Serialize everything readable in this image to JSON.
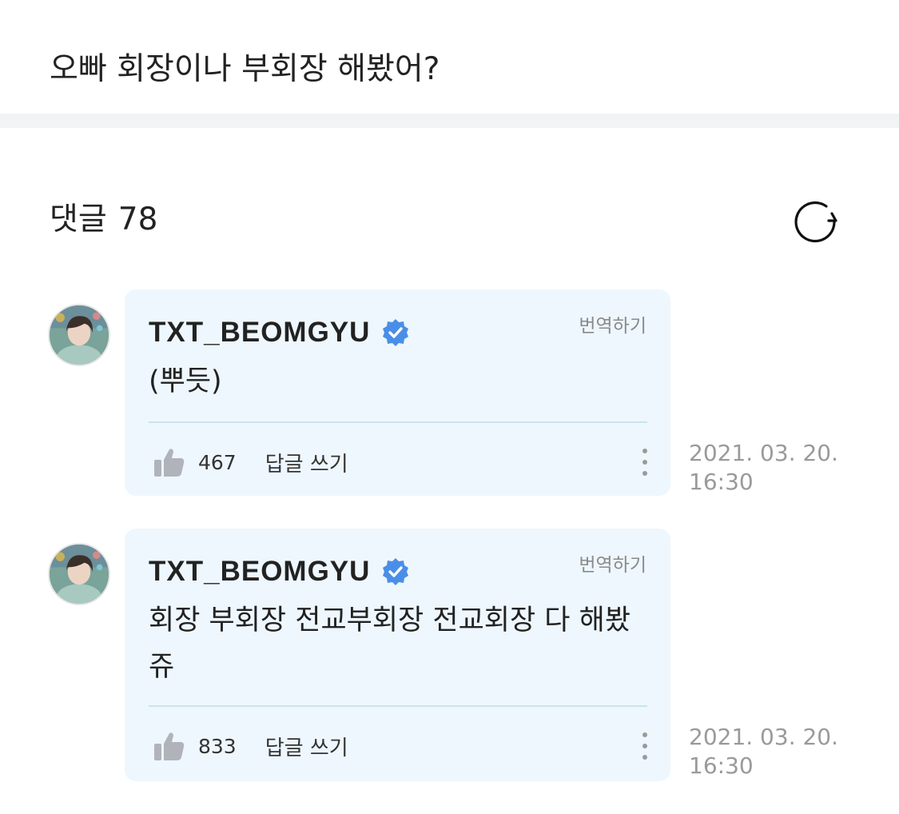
{
  "post": {
    "title": "오빠 회장이나 부회장 해봤어?"
  },
  "comments_section": {
    "label": "댓글",
    "count": "78",
    "refresh_icon": "refresh-icon"
  },
  "comments": [
    {
      "author": "TXT_BEOMGYU",
      "verified_icon": "verified-badge-icon",
      "translate_label": "번역하기",
      "body": "(뿌듯)",
      "like_icon": "thumbs-up-icon",
      "likes": "467",
      "reply_label": "답글 쓰기",
      "more_icon": "more-vertical-icon",
      "date": "2021. 03. 20.",
      "time": "16:30"
    },
    {
      "author": "TXT_BEOMGYU",
      "verified_icon": "verified-badge-icon",
      "translate_label": "번역하기",
      "body": "회장 부회장 전교부회장 전교회장 다 해봤쥬",
      "like_icon": "thumbs-up-icon",
      "likes": "833",
      "reply_label": "답글 쓰기",
      "more_icon": "more-vertical-icon",
      "date": "2021. 03. 20.",
      "time": "16:30"
    }
  ],
  "colors": {
    "bubble_background": "#eef7fd",
    "verified_badge": "#4a8fe7",
    "divider": "#f2f3f5",
    "muted_text": "#9a9a9a"
  }
}
